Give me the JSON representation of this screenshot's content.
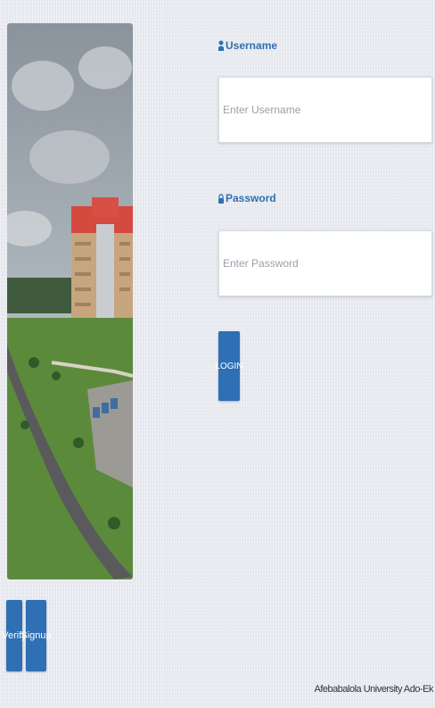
{
  "login": {
    "username_label": "Username",
    "username_placeholder": "Enter Username",
    "password_label": "Password",
    "password_placeholder": "Enter Password",
    "login_button": "LOGIN"
  },
  "side_buttons": {
    "verify": "Verify",
    "signup": "Signup"
  },
  "footer": {
    "text": "Afebabalola University Ado-Ek"
  },
  "colors": {
    "accent": "#2f6fb3",
    "background": "#e7eaf0"
  }
}
